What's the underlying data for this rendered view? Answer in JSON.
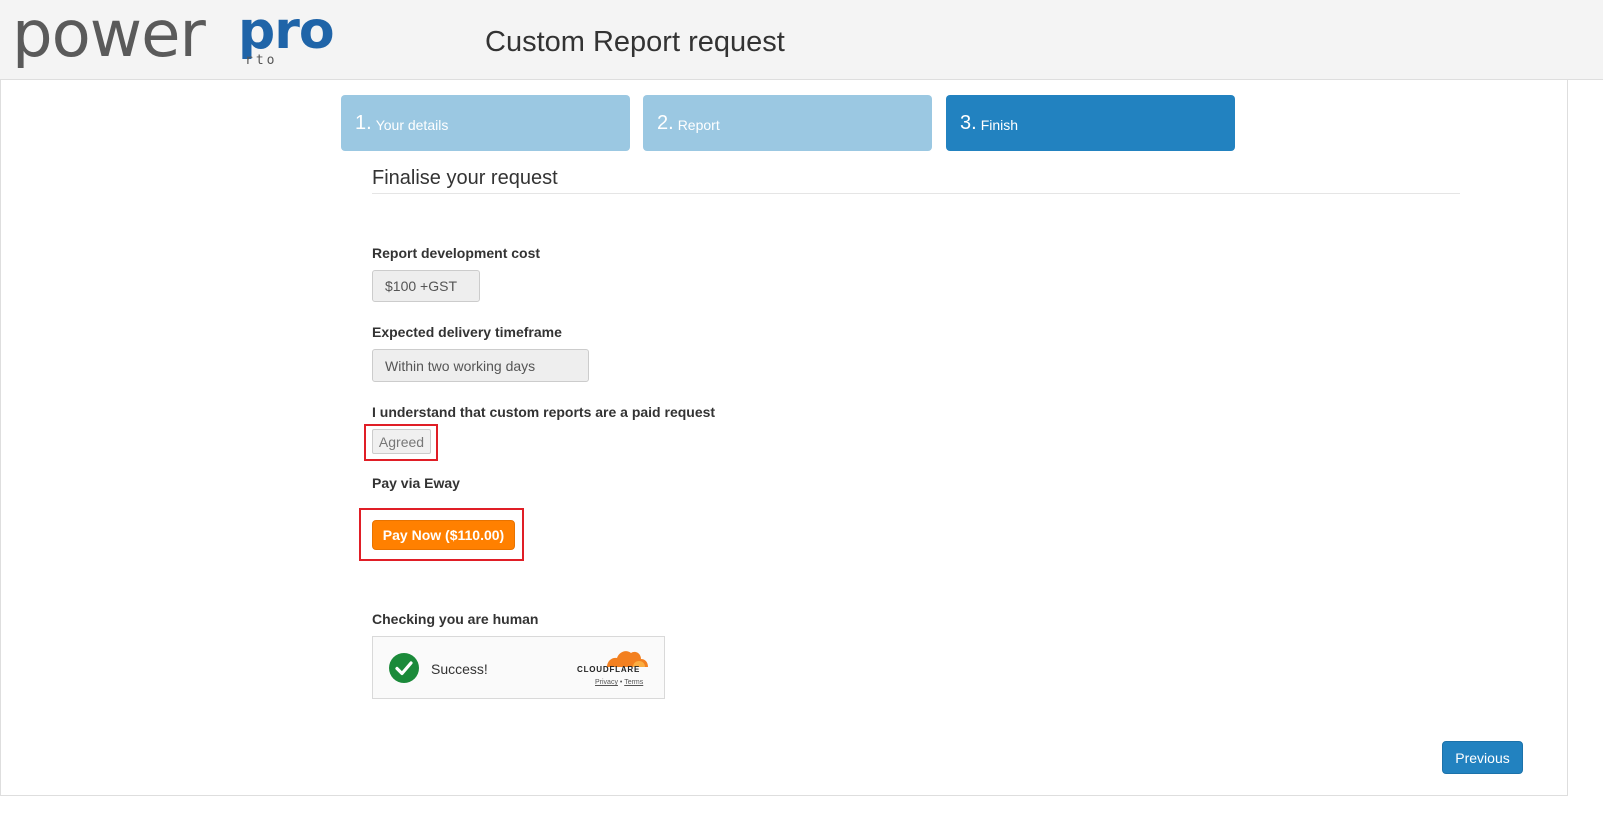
{
  "header": {
    "logo": {
      "text_left": "power",
      "text_right": "pro",
      "subtext": "rto"
    },
    "title": "Custom Report request"
  },
  "steps": [
    {
      "num": "1.",
      "label": "Your details",
      "state": "done"
    },
    {
      "num": "2.",
      "label": "Report",
      "state": "done"
    },
    {
      "num": "3.",
      "label": "Finish",
      "state": "active"
    }
  ],
  "form": {
    "section_title": "Finalise your request",
    "cost_label": "Report development cost",
    "cost_value": "$100 +GST",
    "delivery_label": "Expected delivery timeframe",
    "delivery_value": "Within two working days",
    "agree_label": "I understand that custom reports are a paid request",
    "agree_value": "Agreed",
    "pay_label": "Pay via Eway",
    "pay_button": "Pay Now ($110.00)",
    "human_label": "Checking you are human",
    "captcha": {
      "status": "Success!",
      "brand": "CLOUDFLARE",
      "privacy": "Privacy",
      "separator": "•",
      "terms": "Terms"
    }
  },
  "footer": {
    "previous_button": "Previous"
  },
  "colors": {
    "accent": "#2282c0",
    "step_done": "#9bc8e2",
    "pay_button": "#ff8000",
    "highlight": "#e01e26",
    "success": "#1b8a3a",
    "cloudflare": "#f38020"
  }
}
